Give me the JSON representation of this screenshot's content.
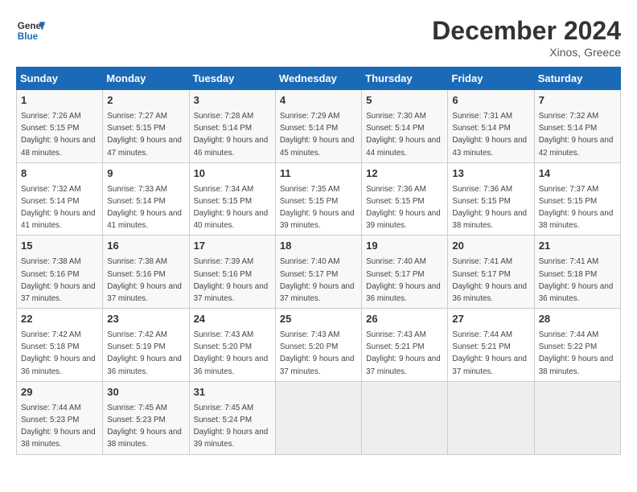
{
  "header": {
    "logo_line1": "General",
    "logo_line2": "Blue",
    "month": "December 2024",
    "location": "Xinos, Greece"
  },
  "weekdays": [
    "Sunday",
    "Monday",
    "Tuesday",
    "Wednesday",
    "Thursday",
    "Friday",
    "Saturday"
  ],
  "weeks": [
    [
      {
        "day": 1,
        "sunrise": "7:26 AM",
        "sunset": "5:15 PM",
        "daylight": "9 hours and 48 minutes."
      },
      {
        "day": 2,
        "sunrise": "7:27 AM",
        "sunset": "5:15 PM",
        "daylight": "9 hours and 47 minutes."
      },
      {
        "day": 3,
        "sunrise": "7:28 AM",
        "sunset": "5:14 PM",
        "daylight": "9 hours and 46 minutes."
      },
      {
        "day": 4,
        "sunrise": "7:29 AM",
        "sunset": "5:14 PM",
        "daylight": "9 hours and 45 minutes."
      },
      {
        "day": 5,
        "sunrise": "7:30 AM",
        "sunset": "5:14 PM",
        "daylight": "9 hours and 44 minutes."
      },
      {
        "day": 6,
        "sunrise": "7:31 AM",
        "sunset": "5:14 PM",
        "daylight": "9 hours and 43 minutes."
      },
      {
        "day": 7,
        "sunrise": "7:32 AM",
        "sunset": "5:14 PM",
        "daylight": "9 hours and 42 minutes."
      }
    ],
    [
      {
        "day": 8,
        "sunrise": "7:32 AM",
        "sunset": "5:14 PM",
        "daylight": "9 hours and 41 minutes."
      },
      {
        "day": 9,
        "sunrise": "7:33 AM",
        "sunset": "5:14 PM",
        "daylight": "9 hours and 41 minutes."
      },
      {
        "day": 10,
        "sunrise": "7:34 AM",
        "sunset": "5:15 PM",
        "daylight": "9 hours and 40 minutes."
      },
      {
        "day": 11,
        "sunrise": "7:35 AM",
        "sunset": "5:15 PM",
        "daylight": "9 hours and 39 minutes."
      },
      {
        "day": 12,
        "sunrise": "7:36 AM",
        "sunset": "5:15 PM",
        "daylight": "9 hours and 39 minutes."
      },
      {
        "day": 13,
        "sunrise": "7:36 AM",
        "sunset": "5:15 PM",
        "daylight": "9 hours and 38 minutes."
      },
      {
        "day": 14,
        "sunrise": "7:37 AM",
        "sunset": "5:15 PM",
        "daylight": "9 hours and 38 minutes."
      }
    ],
    [
      {
        "day": 15,
        "sunrise": "7:38 AM",
        "sunset": "5:16 PM",
        "daylight": "9 hours and 37 minutes."
      },
      {
        "day": 16,
        "sunrise": "7:38 AM",
        "sunset": "5:16 PM",
        "daylight": "9 hours and 37 minutes."
      },
      {
        "day": 17,
        "sunrise": "7:39 AM",
        "sunset": "5:16 PM",
        "daylight": "9 hours and 37 minutes."
      },
      {
        "day": 18,
        "sunrise": "7:40 AM",
        "sunset": "5:17 PM",
        "daylight": "9 hours and 37 minutes."
      },
      {
        "day": 19,
        "sunrise": "7:40 AM",
        "sunset": "5:17 PM",
        "daylight": "9 hours and 36 minutes."
      },
      {
        "day": 20,
        "sunrise": "7:41 AM",
        "sunset": "5:17 PM",
        "daylight": "9 hours and 36 minutes."
      },
      {
        "day": 21,
        "sunrise": "7:41 AM",
        "sunset": "5:18 PM",
        "daylight": "9 hours and 36 minutes."
      }
    ],
    [
      {
        "day": 22,
        "sunrise": "7:42 AM",
        "sunset": "5:18 PM",
        "daylight": "9 hours and 36 minutes."
      },
      {
        "day": 23,
        "sunrise": "7:42 AM",
        "sunset": "5:19 PM",
        "daylight": "9 hours and 36 minutes."
      },
      {
        "day": 24,
        "sunrise": "7:43 AM",
        "sunset": "5:20 PM",
        "daylight": "9 hours and 36 minutes."
      },
      {
        "day": 25,
        "sunrise": "7:43 AM",
        "sunset": "5:20 PM",
        "daylight": "9 hours and 37 minutes."
      },
      {
        "day": 26,
        "sunrise": "7:43 AM",
        "sunset": "5:21 PM",
        "daylight": "9 hours and 37 minutes."
      },
      {
        "day": 27,
        "sunrise": "7:44 AM",
        "sunset": "5:21 PM",
        "daylight": "9 hours and 37 minutes."
      },
      {
        "day": 28,
        "sunrise": "7:44 AM",
        "sunset": "5:22 PM",
        "daylight": "9 hours and 38 minutes."
      }
    ],
    [
      {
        "day": 29,
        "sunrise": "7:44 AM",
        "sunset": "5:23 PM",
        "daylight": "9 hours and 38 minutes."
      },
      {
        "day": 30,
        "sunrise": "7:45 AM",
        "sunset": "5:23 PM",
        "daylight": "9 hours and 38 minutes."
      },
      {
        "day": 31,
        "sunrise": "7:45 AM",
        "sunset": "5:24 PM",
        "daylight": "9 hours and 39 minutes."
      },
      null,
      null,
      null,
      null
    ]
  ],
  "labels": {
    "sunrise": "Sunrise:",
    "sunset": "Sunset:",
    "daylight": "Daylight:"
  }
}
